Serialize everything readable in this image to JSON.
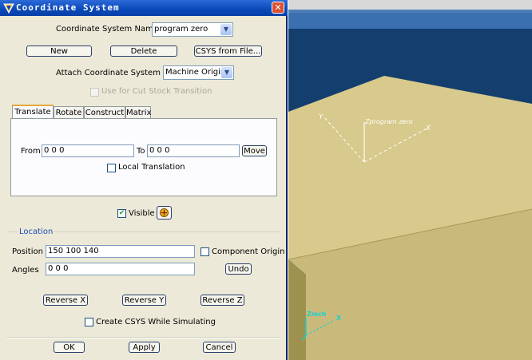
{
  "dialog": {
    "title": "Coordinate System",
    "close_symbol": "✕",
    "csys_name_label": "Coordinate System Name",
    "csys_name_value": "program zero",
    "new_label": "New",
    "delete_label": "Delete",
    "from_file_label": "CSYS from File...",
    "attach_label": "Attach Coordinate System To",
    "attach_value": "Machine Origin",
    "cut_stock_label": "Use for Cut Stock Transition",
    "tabs": [
      {
        "label": "Translate",
        "active": true
      },
      {
        "label": "Rotate",
        "active": false
      },
      {
        "label": "Construct",
        "active": false
      },
      {
        "label": "Matrix",
        "active": false
      }
    ],
    "from_label": "From",
    "from_value": "0 0 0",
    "to_label": "To",
    "to_value": "0 0 0",
    "move_label": "Move",
    "local_translation_label": "Local Translation",
    "visible_label": "Visible",
    "visible_checked": "✔",
    "location_label": "Location",
    "position_label": "Position",
    "position_value": "150 100 140",
    "component_origin_label": "Component Origin",
    "angles_label": "Angles",
    "angles_value": "0 0 0",
    "undo_label": "Undo",
    "reverse_x_label": "Reverse X",
    "reverse_y_label": "Reverse Y",
    "reverse_z_label": "Reverse Z",
    "create_csys_label": "Create CSYS While Simulating",
    "ok_label": "OK",
    "apply_label": "Apply",
    "cancel_label": "Cancel"
  },
  "viewport": {
    "csys_y_label": "Y",
    "csys_z_label": "Zprogram zero",
    "csys_x_label": "X",
    "mch_z_label": "Zmch",
    "mch_x_label": "X"
  },
  "icons": {
    "app": "app-logo-icon",
    "close": "close-icon",
    "combo_arrow": "chevron-down-icon",
    "pick": "pick-location-icon"
  },
  "colors": {
    "block_top": "#d8c98c",
    "block_front": "#c8b97a",
    "block_side": "#b3a466",
    "viewport_bg": "#143e6e",
    "titlebar": "#0a48b8",
    "dialog_bg": "#ece9d8",
    "location_legend": "#1f4bb5",
    "mch_axis": "#19d0d0"
  }
}
